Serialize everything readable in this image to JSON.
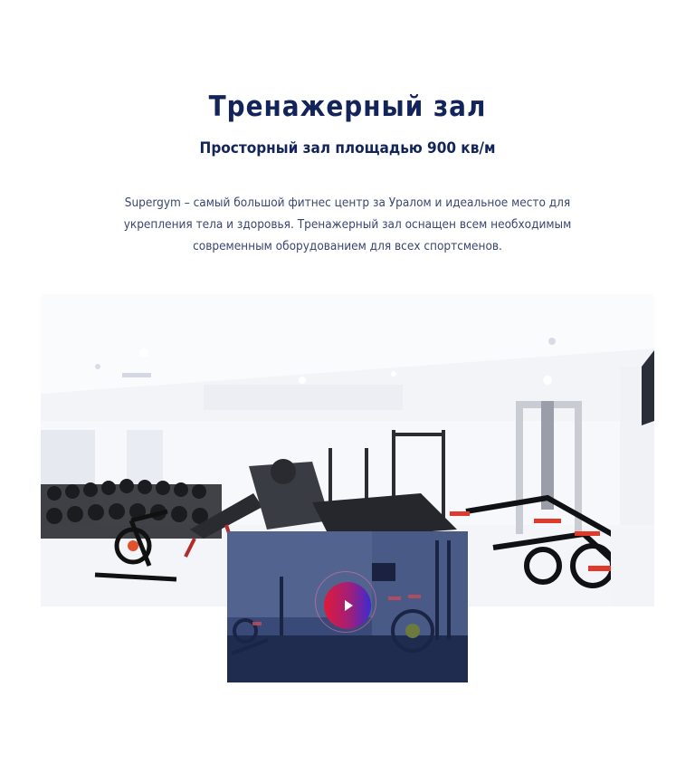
{
  "section": {
    "title": "Тренажерный зал",
    "subtitle": "Просторный зал площадью 900 кв/м",
    "description": "Supergym – самый большой фитнес центр за Уралом и идеальное место для укрепления тела и здоровья. Тренажерный зал оснащен всем необходимым современным оборудованием для всех спортсменов."
  },
  "media": {
    "main_photo_icon": "gym-photo",
    "video_icon": "play-icon"
  },
  "colors": {
    "heading": "#12245a",
    "body_text": "#3a4670",
    "play_gradient_start": "#e01a3b",
    "play_gradient_end": "#3b2bd1",
    "video_overlay": "#1c2a55"
  }
}
